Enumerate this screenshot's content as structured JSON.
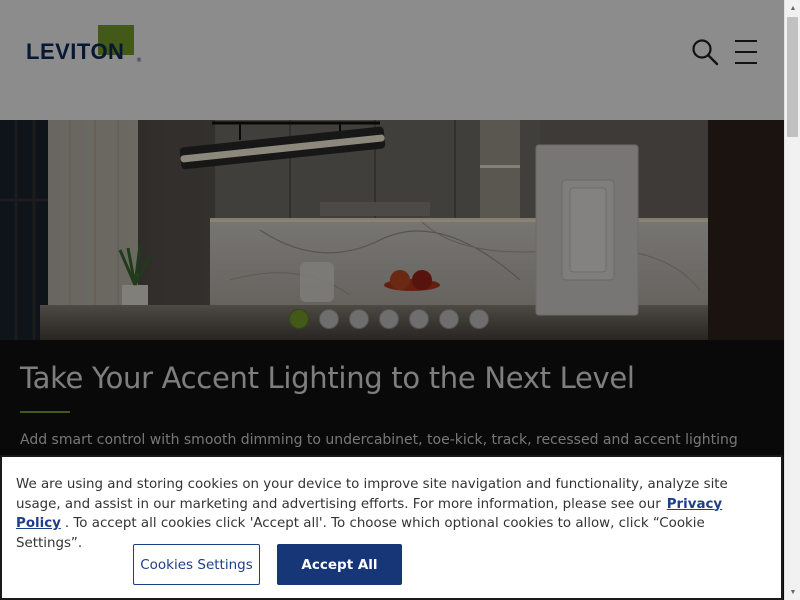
{
  "header": {
    "logo_text": "LEVITON",
    "logo_reg": "®",
    "search_icon": "search-icon",
    "menu_icon": "hamburger-menu-icon"
  },
  "hero": {
    "slide_count": 7,
    "active_slide": 1,
    "accent_color": "#7aa32b"
  },
  "content": {
    "title": "Take Your Accent Lighting to the Next Level",
    "description": "Add smart control with smooth dimming to undercabinet, toe-kick, track, recessed and accent lighting"
  },
  "cookie_banner": {
    "text_part1": "We are using and storing cookies on your device to improve site navigation and functionality, analyze site usage, and assist in our marketing and advertising efforts. For more information, please see our",
    "privacy_link": "Privacy Policy",
    "text_part2": ". To accept all cookies click 'Accept all'.  To choose which optional cookies to allow, click “Cookie Settings”.",
    "settings_button": "Cookies Settings",
    "accept_button": "Accept All",
    "primary_color": "#163678"
  },
  "scrollbar": {
    "up_glyph": "▲",
    "down_glyph": "▼"
  }
}
